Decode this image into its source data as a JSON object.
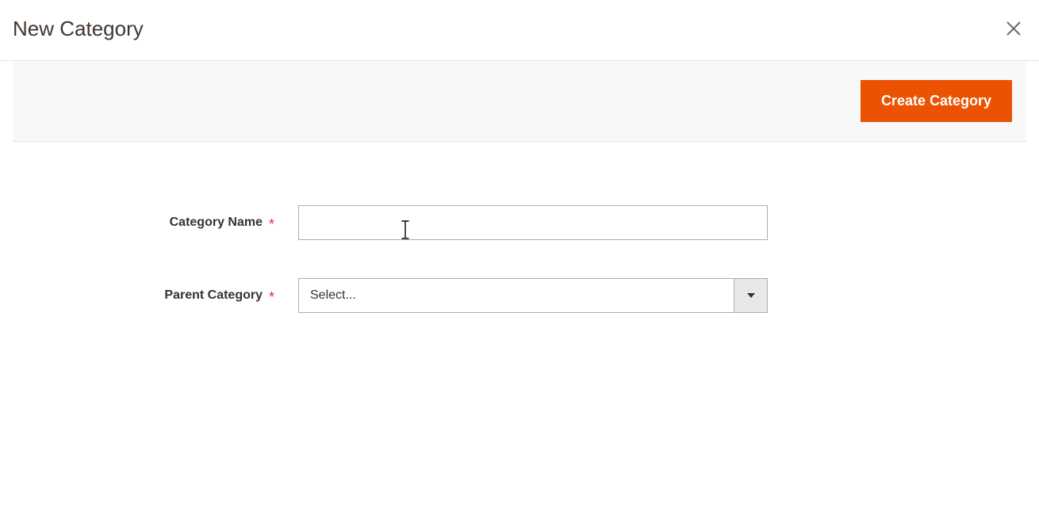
{
  "modal": {
    "title": "New Category"
  },
  "actions": {
    "create_label": "Create Category"
  },
  "form": {
    "category_name": {
      "label": "Category Name",
      "value": ""
    },
    "parent_category": {
      "label": "Parent Category",
      "placeholder": "Select..."
    }
  }
}
